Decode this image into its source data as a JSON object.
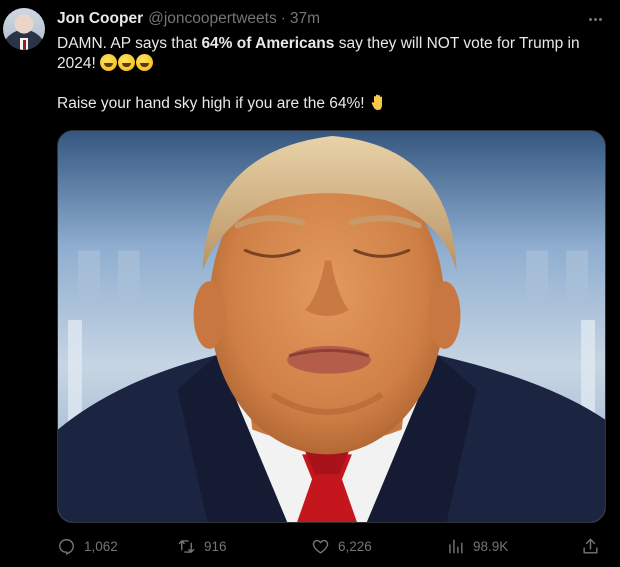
{
  "author": {
    "name": "Jon Cooper",
    "handle": "@joncoopertweets",
    "separator": "·",
    "time": "37m"
  },
  "tweet": {
    "line1_pre": "DAMN. AP says that ",
    "line1_bold": "64% of Americans",
    "line1_post": " say they will NOT vote for Trump in 2024! ",
    "emojis": [
      "rofl-emoji",
      "rofl-emoji",
      "rofl-emoji"
    ],
    "line2": "Raise your hand sky high if you are the 64%! ",
    "line2_emoji": "raised-hand-emoji"
  },
  "media": {
    "alt": "photo",
    "colors": {
      "suit": "#1b2440",
      "tie": "#c4161c",
      "skin": "#d9894f",
      "hair": "#d8b98a",
      "shirt": "#f3f3f3"
    }
  },
  "actions": {
    "replies": "1,062",
    "retweets": "916",
    "likes": "6,226",
    "views": "98.9K"
  },
  "colors": {
    "background": "#000000",
    "text": "#e7e9ea",
    "muted": "#71767b"
  }
}
